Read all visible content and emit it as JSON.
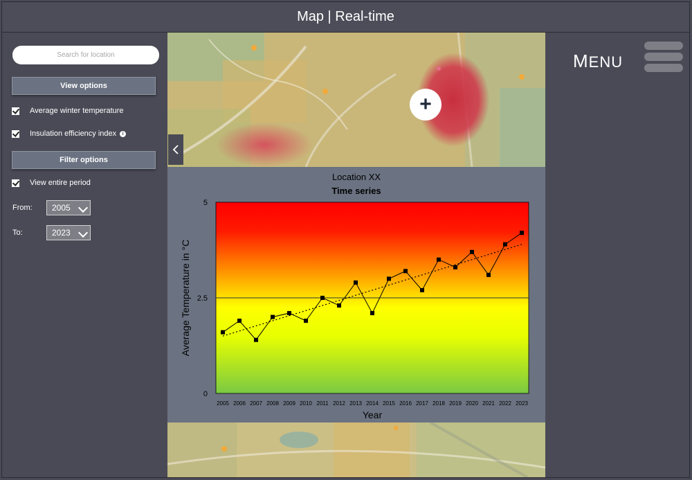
{
  "window": {
    "title": "Map | Real-time"
  },
  "sidebar": {
    "search_placeholder": "Search for location",
    "view_options_label": "View options",
    "view_items": [
      {
        "label": "Average winter temperature",
        "checked": true
      },
      {
        "label": "Insulation efficiency index",
        "checked": true,
        "icon": "info-icon"
      }
    ],
    "filter_options_label": "Filter options",
    "view_entire_period_label": "View entire period",
    "from_label": "From:",
    "from_value": "2005",
    "to_label": "To:",
    "to_value": "2023",
    "collapse_icon": "chevron-left-icon"
  },
  "map": {
    "add_icon": "plus-icon",
    "add_label": "+"
  },
  "menu": {
    "label_first": "M",
    "label_rest": "ENU",
    "icon": "hamburger-icon"
  },
  "chart_panel": {
    "location": "Location XX",
    "title": "Time series"
  },
  "chart_data": {
    "type": "line",
    "x": [
      2005,
      2006,
      2007,
      2008,
      2009,
      2010,
      2011,
      2012,
      2013,
      2014,
      2015,
      2016,
      2017,
      2018,
      2019,
      2020,
      2021,
      2022,
      2023
    ],
    "series": [
      {
        "values": [
          1.6,
          1.9,
          1.4,
          2.0,
          2.1,
          1.9,
          2.5,
          2.3,
          2.9,
          2.1,
          3.0,
          3.2,
          2.7,
          3.5,
          3.3,
          3.7,
          3.1,
          3.9,
          4.2
        ]
      }
    ],
    "trendline": {
      "style": "dotted",
      "start": 1.5,
      "end": 3.9
    },
    "reference_line": 2.5,
    "xlabel": "Year",
    "ylabel": "Average Temperature in °C",
    "ylim": [
      0,
      5
    ],
    "yticks": [
      "0",
      "2.5",
      "5"
    ],
    "background": "gradient green-yellow-red",
    "colors": {
      "low": "#7ac943",
      "mid": "#ffff00",
      "high": "#ff0000"
    }
  }
}
